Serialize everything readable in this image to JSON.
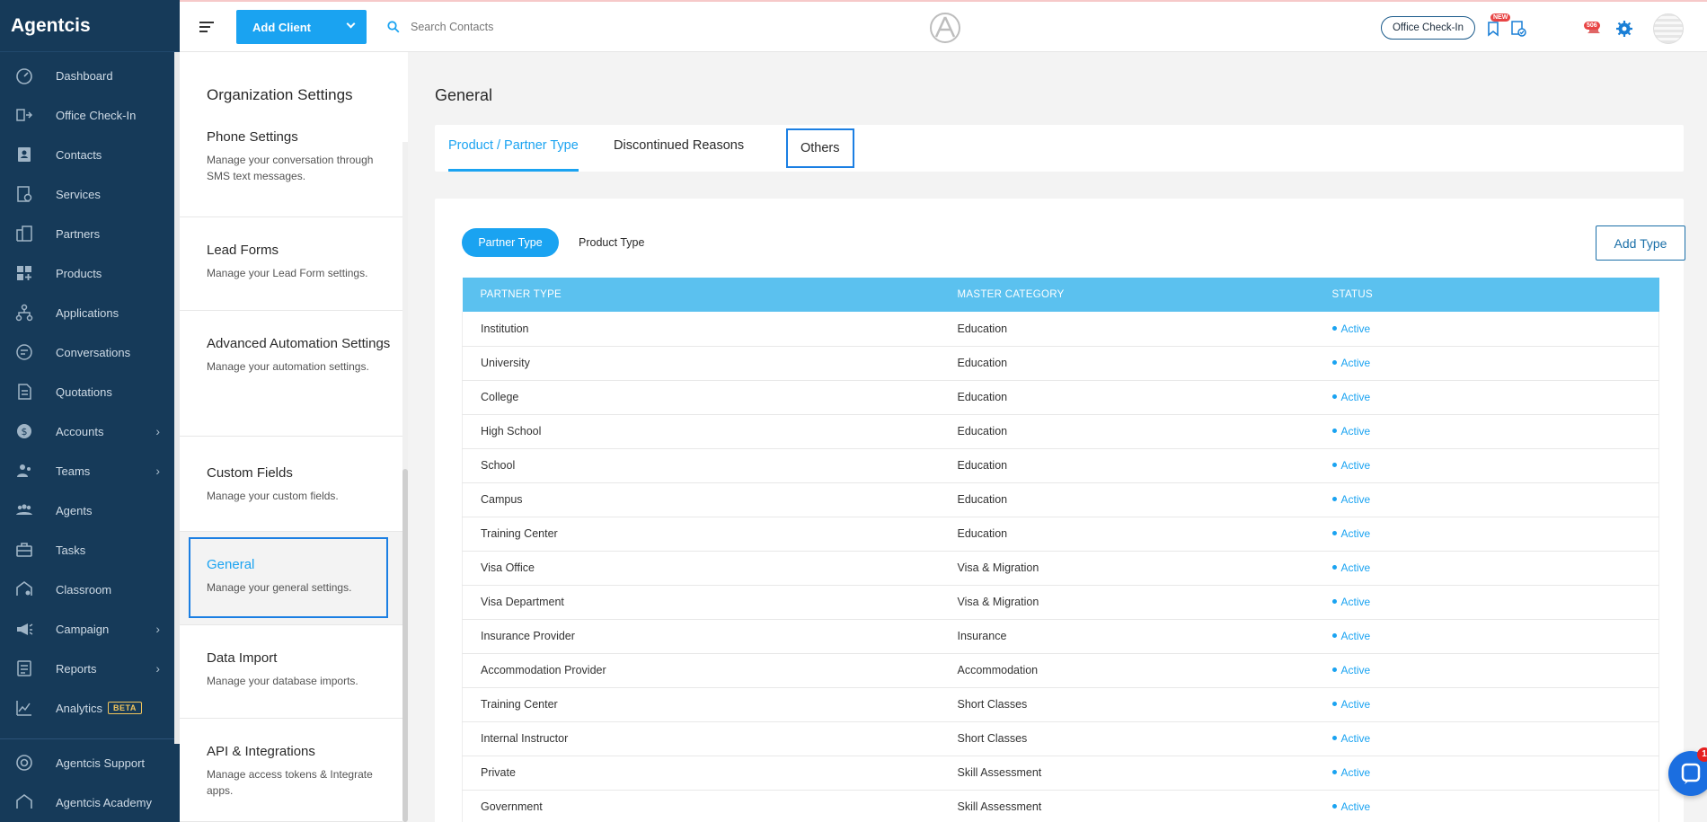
{
  "app": {
    "name": "Agentcis"
  },
  "nav": {
    "items": [
      {
        "label": "Dashboard",
        "icon": "dashboard-icon",
        "chevron": false
      },
      {
        "label": "Office Check-In",
        "icon": "office-checkin-icon",
        "chevron": false
      },
      {
        "label": "Contacts",
        "icon": "contacts-icon",
        "chevron": false
      },
      {
        "label": "Services",
        "icon": "services-icon",
        "chevron": false
      },
      {
        "label": "Partners",
        "icon": "partners-icon",
        "chevron": false
      },
      {
        "label": "Products",
        "icon": "products-icon",
        "chevron": false
      },
      {
        "label": "Applications",
        "icon": "applications-icon",
        "chevron": false
      },
      {
        "label": "Conversations",
        "icon": "conversations-icon",
        "chevron": false
      },
      {
        "label": "Quotations",
        "icon": "quotations-icon",
        "chevron": false
      },
      {
        "label": "Accounts",
        "icon": "accounts-icon",
        "chevron": true
      },
      {
        "label": "Teams",
        "icon": "teams-icon",
        "chevron": true
      },
      {
        "label": "Agents",
        "icon": "agents-icon",
        "chevron": false
      },
      {
        "label": "Tasks",
        "icon": "tasks-icon",
        "chevron": false
      },
      {
        "label": "Classroom",
        "icon": "classroom-icon",
        "chevron": false
      },
      {
        "label": "Campaign",
        "icon": "campaign-icon",
        "chevron": true
      },
      {
        "label": "Reports",
        "icon": "reports-icon",
        "chevron": true
      },
      {
        "label": "Analytics",
        "icon": "analytics-icon",
        "chevron": false,
        "badge": "BETA"
      }
    ],
    "bottom": [
      {
        "label": "Agentcis Support",
        "icon": "support-icon"
      },
      {
        "label": "Agentcis Academy",
        "icon": "academy-icon"
      }
    ]
  },
  "topbar": {
    "add_client_label": "Add Client",
    "search_placeholder": "Search Contacts",
    "office_checkin_label": "Office Check-In",
    "new_badge": "NEW",
    "notif_badge": "506"
  },
  "settings_menu": {
    "title": "Organization Settings",
    "items": [
      {
        "title": "Phone Settings",
        "desc": "Manage your conversation through SMS text messages."
      },
      {
        "title": "Lead Forms",
        "desc": "Manage your Lead Form settings."
      },
      {
        "title": "Advanced Automation Settings",
        "desc": "Manage your automation settings."
      },
      {
        "title": "Custom Fields",
        "desc": "Manage your custom fields."
      },
      {
        "title": "General",
        "desc": "Manage your general settings.",
        "active": true
      },
      {
        "title": "Data Import",
        "desc": "Manage your database imports."
      },
      {
        "title": "API & Integrations",
        "desc": "Manage access tokens & Integrate apps."
      }
    ]
  },
  "main": {
    "title": "General",
    "tabs": [
      "Product / Partner Type",
      "Discontinued Reasons",
      "Others"
    ],
    "active_tab": "Product / Partner Type",
    "pill_partner": "Partner Type",
    "pill_product": "Product Type",
    "add_type_label": "Add Type",
    "table": {
      "headers": [
        "PARTNER TYPE",
        "MASTER CATEGORY",
        "STATUS"
      ],
      "rows": [
        [
          "Institution",
          "Education",
          "Active"
        ],
        [
          "University",
          "Education",
          "Active"
        ],
        [
          "College",
          "Education",
          "Active"
        ],
        [
          "High School",
          "Education",
          "Active"
        ],
        [
          "School",
          "Education",
          "Active"
        ],
        [
          "Campus",
          "Education",
          "Active"
        ],
        [
          "Training Center",
          "Education",
          "Active"
        ],
        [
          "Visa Office",
          "Visa & Migration",
          "Active"
        ],
        [
          "Visa Department",
          "Visa & Migration",
          "Active"
        ],
        [
          "Insurance Provider",
          "Insurance",
          "Active"
        ],
        [
          "Accommodation Provider",
          "Accommodation",
          "Active"
        ],
        [
          "Training Center",
          "Short Classes",
          "Active"
        ],
        [
          "Internal Instructor",
          "Short Classes",
          "Active"
        ],
        [
          "Private",
          "Skill Assessment",
          "Active"
        ],
        [
          "Government",
          "Skill Assessment",
          "Active"
        ]
      ]
    }
  },
  "chat": {
    "badge": "1"
  },
  "colors": {
    "accent": "#1aa3f1",
    "sidebar": "#163a59",
    "table_header": "#5bc1ef",
    "focus_outline": "#1b7fe3"
  }
}
